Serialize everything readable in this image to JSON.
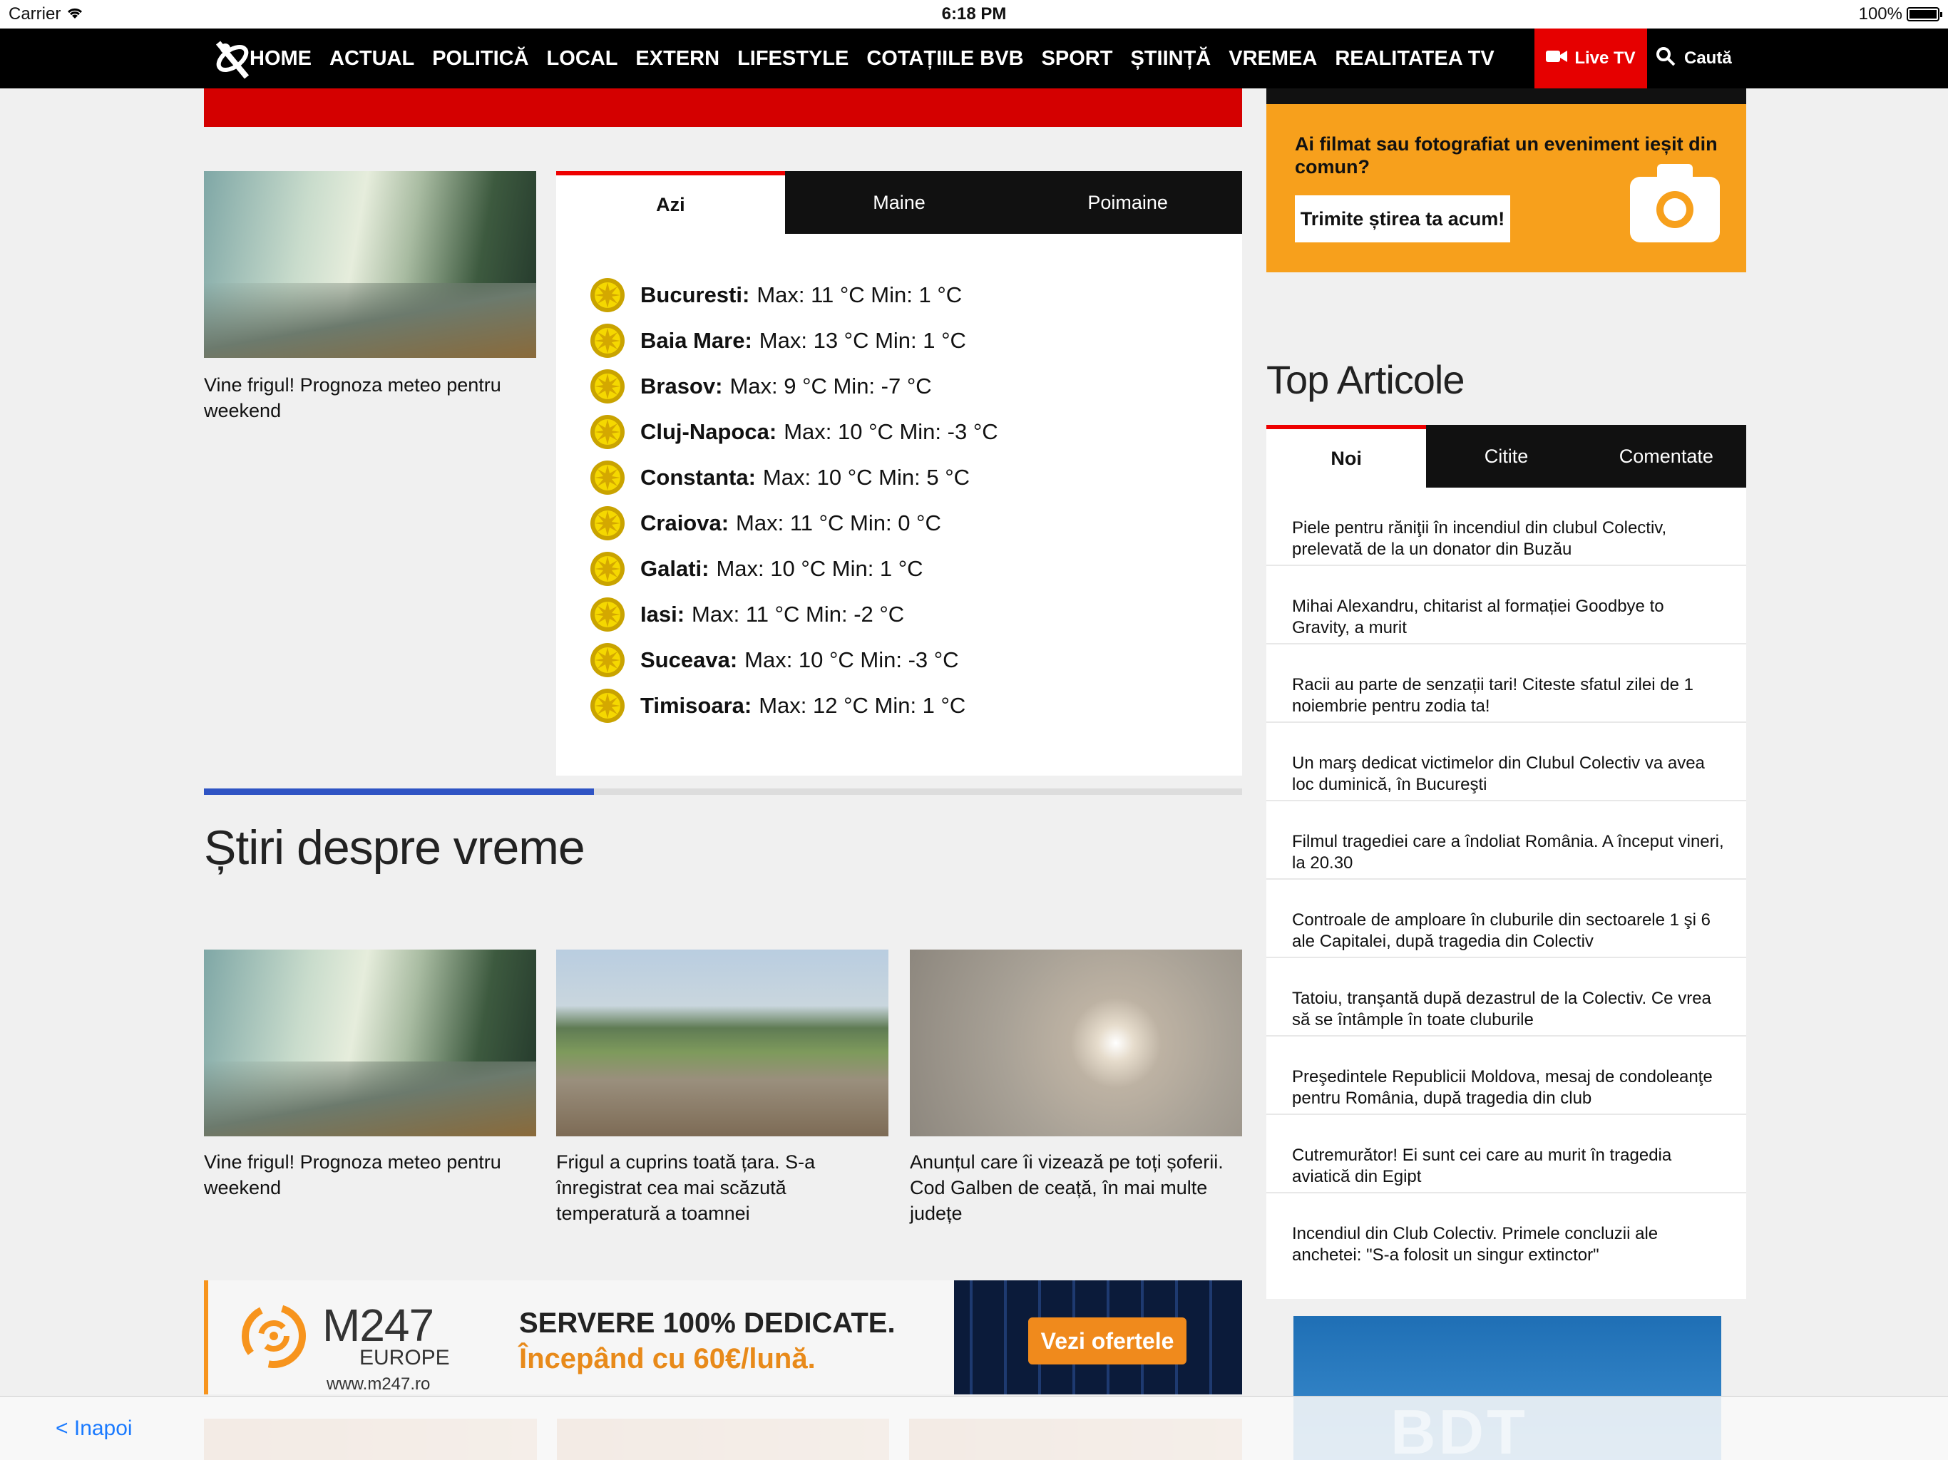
{
  "status_bar": {
    "carrier": "Carrier",
    "time": "6:18 PM",
    "battery": "100%"
  },
  "nav": {
    "items": [
      "HOME",
      "ACTUAL",
      "POLITICĂ",
      "LOCAL",
      "EXTERN",
      "LIFESTYLE",
      "COTAȚIILE BVB",
      "SPORT",
      "ȘTIINȚĂ",
      "VREMEA",
      "REALITATEA TV"
    ],
    "live_tv": "Live TV",
    "search": "Caută"
  },
  "promo": {
    "text": "Ai filmat sau fotografiat un eveniment ieșit din comun?",
    "button": "Trimite știrea ta acum!"
  },
  "featured": {
    "caption": "Vine frigul! Prognoza meteo pentru weekend"
  },
  "weather": {
    "tabs": [
      "Azi",
      "Maine",
      "Poimaine"
    ],
    "active_tab": "Azi",
    "rows": [
      {
        "city": "Bucuresti:",
        "values": "Max: 11 °C Min: 1 °C"
      },
      {
        "city": "Baia Mare:",
        "values": "Max: 13 °C Min: 1 °C"
      },
      {
        "city": "Brasov:",
        "values": "Max: 9 °C Min: -7 °C"
      },
      {
        "city": "Cluj-Napoca:",
        "values": "Max: 10 °C Min: -3 °C"
      },
      {
        "city": "Constanta:",
        "values": "Max: 10 °C Min: 5 °C"
      },
      {
        "city": "Craiova:",
        "values": "Max: 11 °C Min: 0 °C"
      },
      {
        "city": "Galati:",
        "values": "Max: 10 °C Min: 1 °C"
      },
      {
        "city": "Iasi:",
        "values": "Max: 11 °C Min: -2 °C"
      },
      {
        "city": "Suceava:",
        "values": "Max: 10 °C Min: -3 °C"
      },
      {
        "city": "Timisoara:",
        "values": "Max: 12 °C Min: 1 °C"
      }
    ]
  },
  "section": {
    "title": "Știri despre vreme"
  },
  "articles": [
    {
      "caption": "Vine frigul! Prognoza meteo pentru weekend"
    },
    {
      "caption": "Frigul a cuprins toată țara. S-a înregistrat cea mai scăzută temperatură a toamnei"
    },
    {
      "caption": "Anunțul care îi vizează pe toți șoferii. Cod Galben de ceață, în mai multe județe"
    }
  ],
  "top_articles": {
    "title": "Top Articole",
    "tabs": [
      "Noi",
      "Citite",
      "Comentate"
    ],
    "active_tab": "Noi",
    "items": [
      "Piele pentru răniţii în incendiul din clubul Colectiv, prelevată de la un donator din Buzău",
      "Mihai Alexandru, chitarist al formației Goodbye to Gravity, a murit",
      "Racii au parte de senzații tari! Citeste sfatul zilei de 1 noiembrie pentru zodia ta!",
      "Un marş dedicat victimelor din Clubul Colectiv va avea loc duminică, în Bucureşti",
      "Filmul tragediei care a îndoliat România. A început vineri, la 20.30",
      "Controale de amploare în cluburile din sectoarele 1 şi 6 ale Capitalei, după tragedia din Colectiv",
      "Tatoiu, tranşantă după dezastrul de la Colectiv. Ce vrea să se întâmple în toate cluburile",
      "Preşedintele Republicii Moldova, mesaj de condoleanţe pentru România, după tragedia din club",
      "Cutremurător! Ei sunt cei care au murit în tragedia aviatică din Egipt",
      "Incendiul din Club Colectiv. Primele concluzii ale anchetei: \"S-a folosit un singur extinctor\""
    ]
  },
  "ad": {
    "brand": "M247",
    "region": "EUROPE",
    "url": "www.m247.ro",
    "headline": "SERVERE 100% DEDICATE.",
    "subline": "Începând cu 60€/lună.",
    "button": "Vezi ofertele"
  },
  "ad_right": {
    "text": "BDT"
  },
  "toolbar": {
    "back": "<  Inapoi"
  },
  "colors": {
    "accent_red": "#e60000",
    "promo_orange": "#f7a01c",
    "progress_blue": "#2f54c4"
  }
}
